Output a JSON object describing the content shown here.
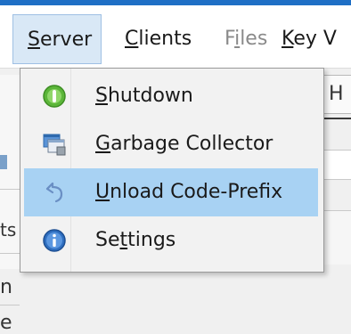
{
  "menubar": {
    "server": {
      "mnemonic": "S",
      "rest": "erver"
    },
    "clients": {
      "mnemonic": "C",
      "rest": "lients"
    },
    "files": {
      "pre": "F",
      "mnemonic": "i",
      "rest": "les"
    },
    "keyv": {
      "mnemonic": "K",
      "rest": "ey V"
    }
  },
  "background": {
    "tab_partial": "H",
    "left_partial_1": "ts",
    "left_partial_2": "n",
    "left_partial_3": "e"
  },
  "server_menu": {
    "items": [
      {
        "icon": "shutdown-icon",
        "mnemonic": "S",
        "rest": "hutdown"
      },
      {
        "icon": "garbage-collector-icon",
        "mnemonic": "G",
        "rest": "arbage Collector"
      },
      {
        "icon": "undo-icon",
        "mnemonic": "U",
        "rest": "nload Code-Prefix"
      },
      {
        "icon": "info-icon",
        "pre": "Se",
        "mnemonic": "t",
        "rest": "tings"
      }
    ],
    "highlighted_index": 2
  },
  "colors": {
    "title_accent": "#1f6fc5",
    "highlight": "#a8d2f3",
    "shutdown_green": "#5cb63a",
    "info_blue": "#2f6fc0"
  }
}
